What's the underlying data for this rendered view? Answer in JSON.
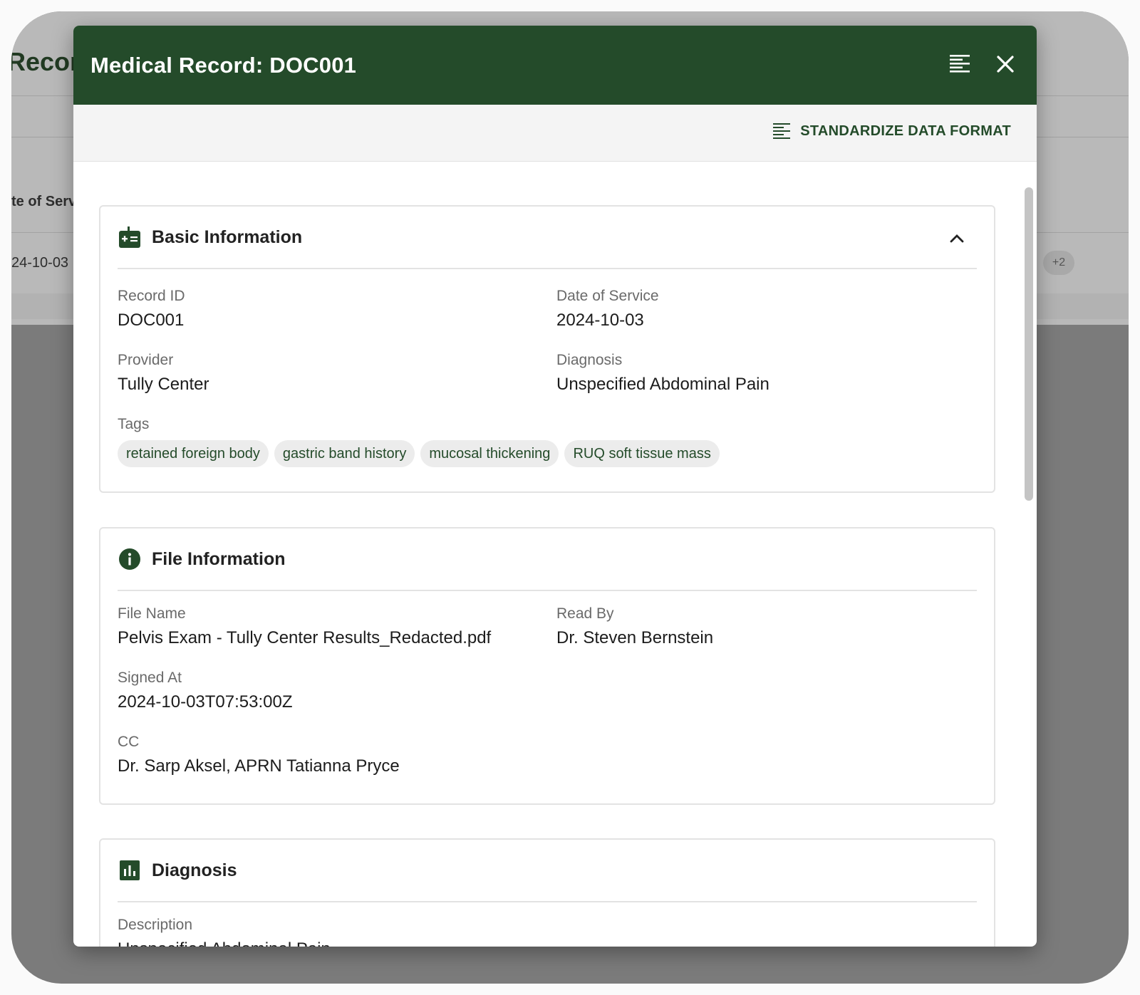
{
  "background": {
    "page_title": "Recor",
    "column_header": "te of Serv",
    "cell_date": "24-10-03",
    "badge": "+2"
  },
  "modal": {
    "title": "Medical Record: DOC001",
    "toolbar": {
      "standardize_label": "STANDARDIZE DATA FORMAT"
    },
    "basic": {
      "title": "Basic Information",
      "record_id_label": "Record ID",
      "record_id": "DOC001",
      "date_label": "Date of Service",
      "date": "2024-10-03",
      "provider_label": "Provider",
      "provider": "Tully Center",
      "diagnosis_label": "Diagnosis",
      "diagnosis": "Unspecified Abdominal Pain",
      "tags_label": "Tags",
      "tags": [
        "retained foreign body",
        "gastric band history",
        "mucosal thickening",
        "RUQ soft tissue mass"
      ]
    },
    "file": {
      "title": "File Information",
      "file_name_label": "File Name",
      "file_name": "Pelvis Exam - Tully Center Results_Redacted.pdf",
      "read_by_label": "Read By",
      "read_by": "Dr. Steven Bernstein",
      "signed_at_label": "Signed At",
      "signed_at": "2024-10-03T07:53:00Z",
      "cc_label": "CC",
      "cc": "Dr. Sarp Aksel, APRN Tatianna Pryce"
    },
    "diagnosis_section": {
      "title": "Diagnosis",
      "description_label": "Description",
      "description": "Unspecified Abdominal Pain"
    }
  },
  "colors": {
    "header": "#244b2a",
    "accent": "#244b2a",
    "tag_bg": "#ececec"
  },
  "icons": {
    "format": "format-align-icon",
    "close": "close-icon",
    "basic": "medical-id-icon",
    "file": "info-icon",
    "diagnosis": "bar-chart-icon",
    "collapse": "chevron-up-icon"
  }
}
